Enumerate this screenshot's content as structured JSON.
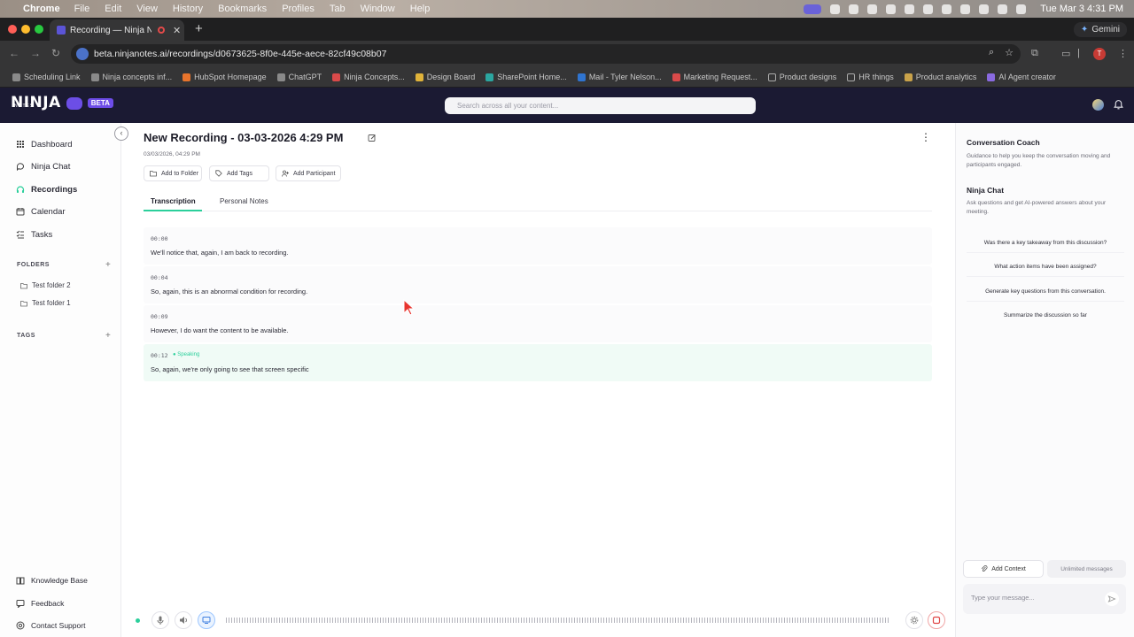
{
  "menubar": {
    "app_name": "Chrome",
    "items": [
      "File",
      "Edit",
      "View",
      "History",
      "Bookmarks",
      "Profiles",
      "Tab",
      "Window",
      "Help"
    ],
    "clock": "Tue Mar 3  4:31 PM"
  },
  "browser": {
    "tab_title": "Recording — Ninja Note",
    "url": "beta.ninjanotes.ai/recordings/d0673625-8f0e-445e-aece-82cf49c08b07",
    "gemini_label": "Gemini",
    "profile_initial": "T",
    "bookmarks": [
      "Scheduling Link",
      "Ninja concepts inf...",
      "HubSpot Homepage",
      "ChatGPT",
      "Ninja Concepts...",
      "Design Board",
      "SharePoint Home...",
      "Mail - Tyler Nelson...",
      "Marketing Request...",
      "Product designs",
      "HR things",
      "Product analytics",
      "AI Agent creator"
    ]
  },
  "app": {
    "logo": "NINJA",
    "logo_sub": "NOTES",
    "beta": "BETA",
    "search_placeholder": "Search across all your content..."
  },
  "sidebar": {
    "nav": [
      {
        "label": "Dashboard",
        "icon": "grid-icon"
      },
      {
        "label": "Ninja Chat",
        "icon": "chat-icon"
      },
      {
        "label": "Recordings",
        "icon": "headphones-icon"
      },
      {
        "label": "Calendar",
        "icon": "calendar-icon"
      },
      {
        "label": "Tasks",
        "icon": "tasks-icon"
      }
    ],
    "folders_label": "FOLDERS",
    "folders": [
      "Test folder 2",
      "Test folder 1"
    ],
    "tags_label": "TAGS",
    "footer": [
      {
        "label": "Knowledge Base",
        "icon": "book-icon"
      },
      {
        "label": "Feedback",
        "icon": "feedback-icon"
      },
      {
        "label": "Contact Support",
        "icon": "support-icon"
      }
    ]
  },
  "recording": {
    "title": "New Recording - 03-03-2026 4:29 PM",
    "date": "03/03/2026, 04:29 PM",
    "actions": [
      "Add to Folder",
      "Add Tags",
      "Add Participant"
    ],
    "tabs": [
      "Transcription",
      "Personal Notes"
    ],
    "segments": [
      {
        "time": "00:00",
        "text": "We'll notice that, again, I am back to recording."
      },
      {
        "time": "00:04",
        "text": "So, again, this is an abnormal condition for recording."
      },
      {
        "time": "00:09",
        "text": "However, I do want the content to be available."
      },
      {
        "time": "00:12",
        "text": "So, again, we're only going to see that screen specific",
        "speaking": "● Speaking"
      }
    ]
  },
  "right_panel": {
    "coach_title": "Conversation Coach",
    "coach_desc": "Guidance to help you keep the conversation moving and participants engaged.",
    "chat_title": "Ninja Chat",
    "chat_desc": "Ask questions and get AI-powered answers about your meeting.",
    "suggestions": [
      "Was there a key takeaway from this discussion?",
      "What action items have been assigned?",
      "Generate key questions from this conversation.",
      "Summarize the discussion so far"
    ],
    "add_context": "Add Context",
    "unlimited": "Unlimited messages",
    "message_placeholder": "Type your message..."
  },
  "colors": {
    "accent_green": "#2bcf9b",
    "brand_purple": "#6d4ce8",
    "header_bg": "#1b1a33"
  }
}
